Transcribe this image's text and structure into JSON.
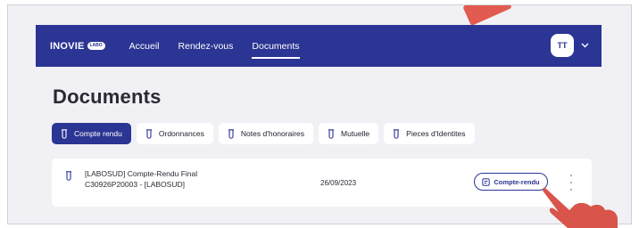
{
  "nav": {
    "brand": "INOVIE",
    "brand_badge": "LABO",
    "links": [
      "Accueil",
      "Rendez-vous",
      "Documents"
    ],
    "active_link": "Documents",
    "user_initials": "TT"
  },
  "page": {
    "title": "Documents"
  },
  "tabs": [
    {
      "label": "Compte rendu",
      "active": true
    },
    {
      "label": "Ordonnances",
      "active": false
    },
    {
      "label": "Notes d'honoraires",
      "active": false
    },
    {
      "label": "Mutuelle",
      "active": false
    },
    {
      "label": "Pieces d'Identites",
      "active": false
    }
  ],
  "documents": [
    {
      "title": "[LABOSUD] Compte-Rendu Final C30926P20003 - [LABOSUD]",
      "date": "26/09/2023",
      "action_label": "Compte-rendu"
    }
  ],
  "colors": {
    "primary": "#2b3593",
    "background": "#f1f1f5",
    "pointer": "#e25b50"
  }
}
